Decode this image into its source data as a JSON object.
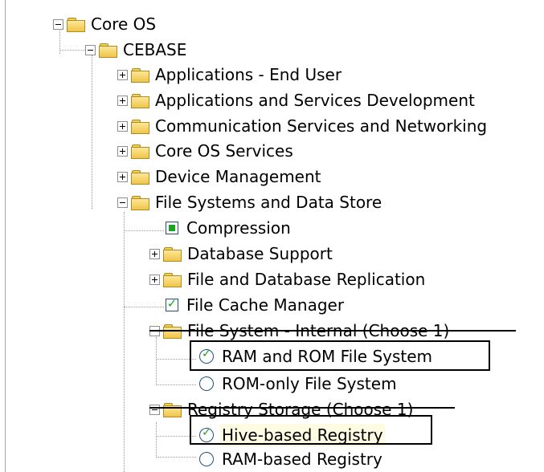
{
  "tree": {
    "root_label": "Core OS",
    "cebase_label": "CEBASE",
    "categories": [
      "Applications - End User",
      "Applications and Services Development",
      "Communication Services and Networking",
      "Core OS Services",
      "Device Management",
      "File Systems and Data Store"
    ],
    "filesystem_items": {
      "compression": "Compression",
      "database_support": "Database Support",
      "file_db_replication": "File and Database Replication",
      "file_cache_manager": "File Cache Manager",
      "fs_internal": "File System - Internal (Choose 1)",
      "ram_rom_fs": "RAM and ROM File System",
      "rom_only_fs": "ROM-only File System",
      "registry_storage": "Registry Storage (Choose 1)",
      "hive_registry": "Hive-based Registry",
      "ram_registry": "RAM-based Registry"
    }
  }
}
